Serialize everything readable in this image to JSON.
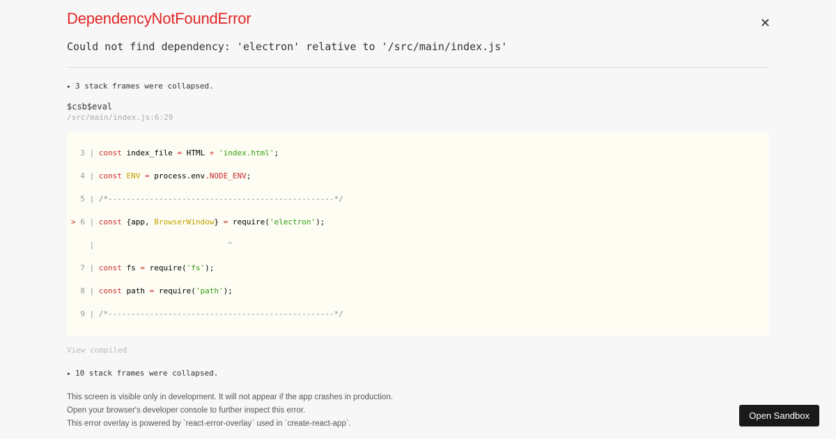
{
  "title": "DependencyNotFoundError",
  "message": "Could not find dependency: 'electron' relative to '/src/main/index.js'",
  "collapsed_top": "3 stack frames were collapsed.",
  "frame": {
    "label": "$csb$eval",
    "location": "/src/main/index.js:6:29"
  },
  "code": {
    "line3": {
      "gutter": "  3 | ",
      "const": "const",
      "ident": " index_file ",
      "op": "=",
      "html": " HTML ",
      "plus": "+",
      "str": " 'index.html'",
      "end": ";"
    },
    "line4": {
      "gutter": "  4 | ",
      "const": "const",
      "env": " ENV ",
      "op": "=",
      "process": " process",
      "dot": ".",
      "envprop": "env",
      "dot2": ".",
      "nodeenv": "NODE_ENV",
      "end": ";"
    },
    "line5": {
      "gutter": "  5 | ",
      "comment": "/*-------------------------------------------------*/"
    },
    "line6": {
      "arrow": "> ",
      "gutter": "6 | ",
      "const": "const",
      "brace": " {",
      "app": "app",
      "comma": ", ",
      "bw": "BrowserWindow",
      "brace2": "} ",
      "op": "=",
      "require": " require(",
      "str": "'electron'",
      "end": ");"
    },
    "caret_line": "    |                             ^",
    "line7": {
      "gutter": "  7 | ",
      "const": "const",
      "fs": " fs ",
      "op": "=",
      "require": " require(",
      "str": "'fs'",
      "end": ");"
    },
    "line8": {
      "gutter": "  8 | ",
      "const": "const",
      "path": " path ",
      "op": "=",
      "require": " require(",
      "str": "'path'",
      "end": ");"
    },
    "line9": {
      "gutter": "  9 | ",
      "comment": "/*-------------------------------------------------*/"
    }
  },
  "view_compiled": "View compiled",
  "collapsed_bottom": "10 stack frames were collapsed.",
  "footer": {
    "l1": "This screen is visible only in development. It will not appear if the app crashes in production.",
    "l2": "Open your browser's developer console to further inspect this error.",
    "l3": "This error overlay is powered by `react-error-overlay` used in `create-react-app`."
  },
  "open_sandbox": "Open Sandbox"
}
